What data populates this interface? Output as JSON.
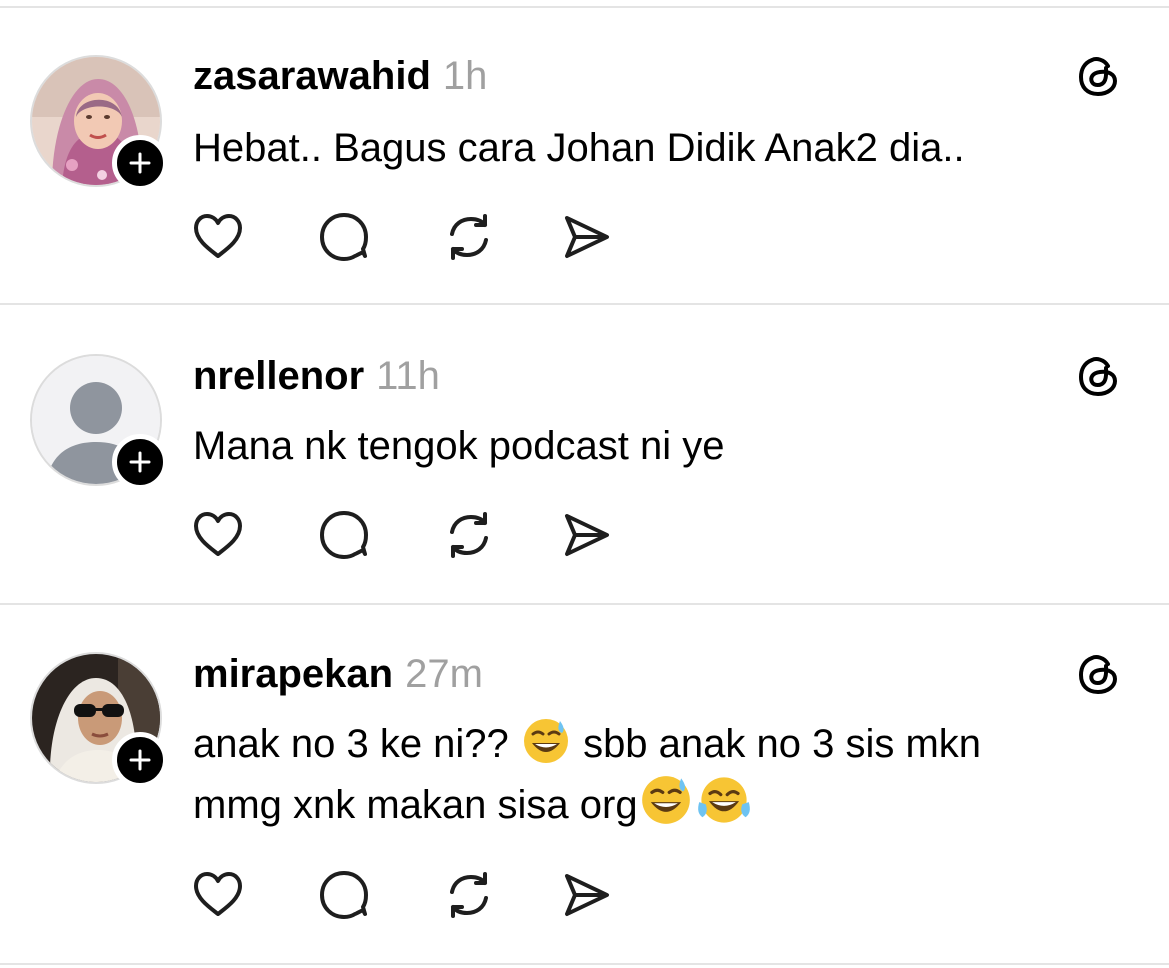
{
  "posts": [
    {
      "username": "zasarawahid",
      "time": "1h",
      "text_lines": [
        "Hebat.. Bagus cara Johan Didik Anak2 dia.."
      ],
      "avatar": "photo-woman-pink-hijab"
    },
    {
      "username": "nrellenor",
      "time": "11h",
      "text_lines": [
        "Mana nk tengok podcast ni ye"
      ],
      "avatar": "default-avatar"
    },
    {
      "username": "mirapekan",
      "time": "27m",
      "text_lines": [
        "anak no 3 ke ni??",
        "sbb anak no 3 sis mkn",
        "mmg xnk makan sisa org"
      ],
      "emojis": [
        "grinning-face-with-sweat",
        "grinning-face-with-sweat",
        "face-with-tears-of-joy"
      ],
      "avatar": "photo-woman-sunglasses-car"
    }
  ],
  "icons": {
    "follow": "plus-icon",
    "like": "heart-icon",
    "reply": "comment-icon",
    "repost": "repost-icon",
    "share": "send-icon",
    "app": "threads-logo-icon"
  },
  "colors": {
    "text": "#000000",
    "muted": "#a0a0a0",
    "divider": "#e4e4e4",
    "icon": "#1e1e1e"
  }
}
